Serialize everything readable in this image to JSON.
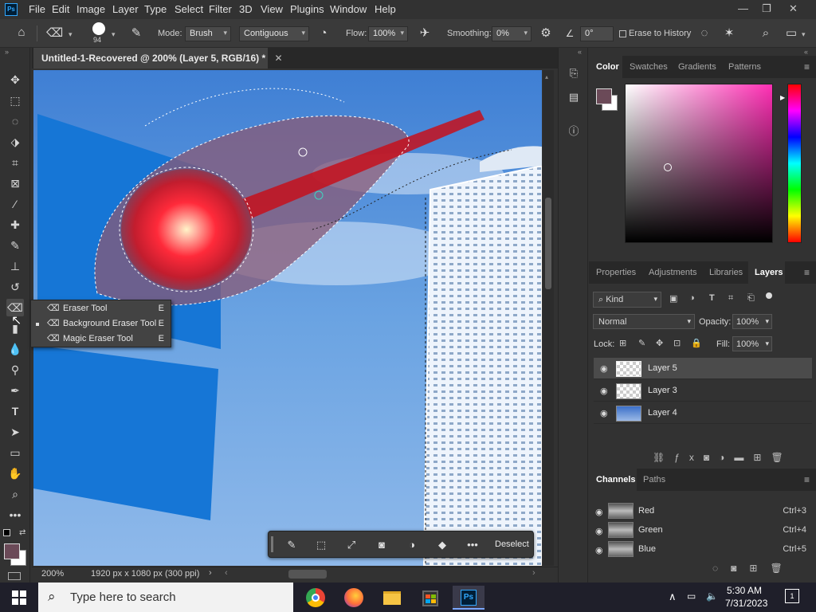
{
  "app": {
    "logo": "Ps",
    "menu": [
      "File",
      "Edit",
      "Image",
      "Layer",
      "Type",
      "Select",
      "Filter",
      "3D",
      "View",
      "Plugins",
      "Window",
      "Help"
    ],
    "window_controls": [
      "—",
      "❐",
      "✕"
    ]
  },
  "options_bar": {
    "brush_size": "94",
    "mode_label": "Mode:",
    "mode_value": "Brush",
    "sampling_value": "Contiguous",
    "flow_label": "Flow:",
    "flow_value": "100%",
    "smoothing_label": "Smoothing:",
    "smoothing_value": "0%",
    "angle_value": "0°",
    "erase_to_history": "Erase to History"
  },
  "document": {
    "tab_title": "Untitled-1-Recovered @ 200% (Layer 5, RGB/16) *",
    "zoom": "200%",
    "doc_info": "1920 px x 1080 px (300 ppi)"
  },
  "tool_flyout": {
    "items": [
      {
        "label": "Eraser Tool",
        "key": "E",
        "icon": "eraser-icon"
      },
      {
        "label": "Background Eraser Tool",
        "key": "E",
        "icon": "background-eraser-icon"
      },
      {
        "label": "Magic Eraser Tool",
        "key": "E",
        "icon": "magic-eraser-icon"
      }
    ]
  },
  "context_bar": {
    "deselect_label": "Deselect"
  },
  "color_panel": {
    "tabs": [
      "Color",
      "Swatches",
      "Gradients",
      "Patterns"
    ],
    "active_tab": "Color",
    "foreground_color": "#6b4a58",
    "hue_color": "#ff2fb4"
  },
  "layers_panel": {
    "tabs": [
      "Properties",
      "Adjustments",
      "Libraries",
      "Layers"
    ],
    "active_tab": "Layers",
    "filter_kind": "Kind",
    "blend_mode": "Normal",
    "opacity_label": "Opacity:",
    "opacity_value": "100%",
    "lock_label": "Lock:",
    "fill_label": "Fill:",
    "fill_value": "100%",
    "layers": [
      {
        "name": "Layer 5",
        "selected": true
      },
      {
        "name": "Layer 3",
        "selected": false
      },
      {
        "name": "Layer 4",
        "selected": false
      }
    ]
  },
  "channels_panel": {
    "tabs": [
      "Channels",
      "Paths"
    ],
    "active_tab": "Channels",
    "channels": [
      {
        "name": "Red",
        "shortcut": "Ctrl+3"
      },
      {
        "name": "Green",
        "shortcut": "Ctrl+4"
      },
      {
        "name": "Blue",
        "shortcut": "Ctrl+5"
      }
    ]
  },
  "taskbar": {
    "search_placeholder": "Type here to search",
    "time": "5:30 AM",
    "date": "7/31/2023",
    "notification_count": "1"
  }
}
